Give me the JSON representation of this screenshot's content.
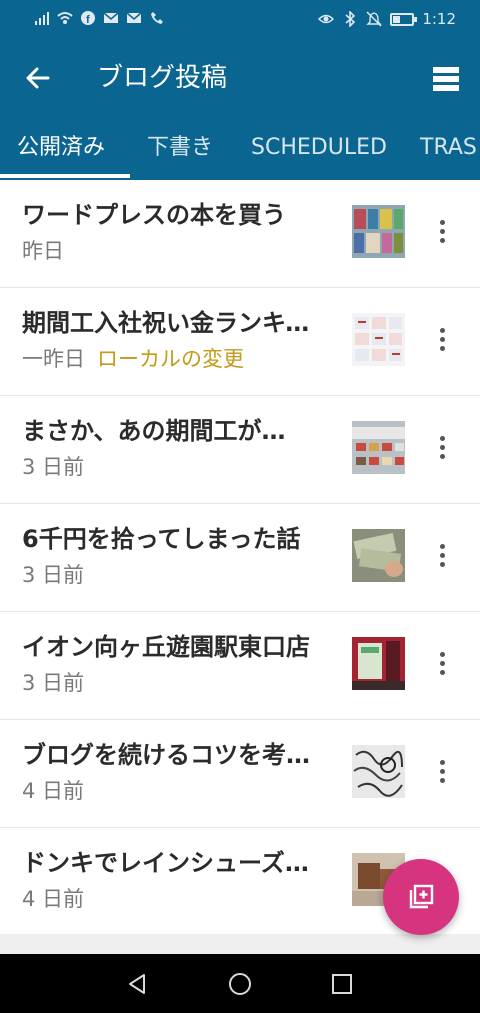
{
  "status_bar": {
    "time": "1:12"
  },
  "header": {
    "title": "ブログ投稿",
    "back_icon": "arrow-left-icon",
    "menu_icon": "stacked-menu-icon"
  },
  "tabs": [
    {
      "label": "公開済み",
      "active": true
    },
    {
      "label": "下書き",
      "active": false
    },
    {
      "label": "SCHEDULED",
      "active": false
    },
    {
      "label": "TRAS",
      "active": false
    }
  ],
  "posts": [
    {
      "title": "ワードプレスの本を買う",
      "date": "昨日",
      "local_change": ""
    },
    {
      "title": "期間工入社祝い金ランキング",
      "date": "一昨日",
      "local_change": "ローカルの変更"
    },
    {
      "title": "まさか、あの期間工が…",
      "date": "3 日前",
      "local_change": ""
    },
    {
      "title": "6千円を拾ってしまった話",
      "date": "3 日前",
      "local_change": ""
    },
    {
      "title": "イオン向ヶ丘遊園駅東口店",
      "date": "3 日前",
      "local_change": ""
    },
    {
      "title": "ブログを続けるコツを考える",
      "date": "4 日前",
      "local_change": ""
    },
    {
      "title": "ドンキでレインシューズを買う",
      "date": "4 日前",
      "local_change": ""
    }
  ],
  "fab": {
    "icon": "new-post-icon"
  },
  "colors": {
    "primary": "#0a6591",
    "accent": "#d6347f",
    "local_change": "#c49a16"
  }
}
